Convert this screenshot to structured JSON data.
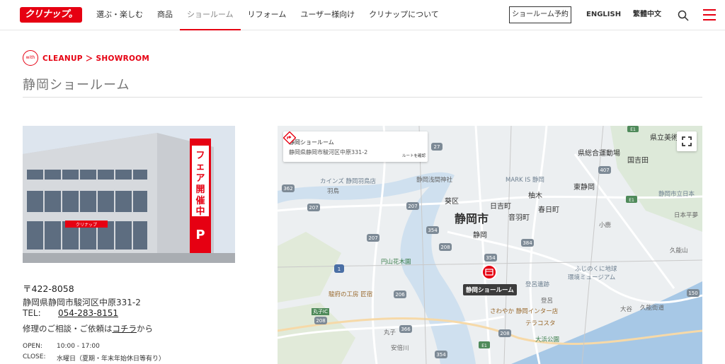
{
  "header": {
    "logo_text": "クリナップ。",
    "nav": [
      "選ぶ・楽しむ",
      "商品",
      "ショールーム",
      "リフォーム",
      "ユーザー様向け",
      "クリナップについて"
    ],
    "active_nav_index": 2,
    "reserve_label": "ショールーム予約",
    "lang_en": "ENGLISH",
    "lang_tw": "繁體中文"
  },
  "brand": {
    "badge": "with",
    "text": "CLEANUP ＞ SHOWROOM"
  },
  "page_title": "静岡ショールーム",
  "photo": {
    "sign_text": "フェア開催中!!",
    "sign_p": "P",
    "building_logo": "クリナップ"
  },
  "info": {
    "postal": "〒422-8058",
    "address": "静岡県静岡市駿河区中原331-2",
    "tel_label": "TEL:",
    "tel": "054-283-8151",
    "repair_text": "修理のご相談・ご依頼は",
    "repair_link": "コチラ",
    "repair_suffix": "から",
    "open_label": "OPEN:",
    "open_value": "10:00 - 17:00",
    "close_label": "CLOSE:",
    "close_value": "水曜日（夏期・年末年始休日等有り）"
  },
  "map": {
    "info_name": "静岡ショールーム",
    "info_addr": "静岡県静岡市駿河区中原331-2",
    "route_label": "ルートを確認",
    "marker_label": "静岡ショールーム",
    "labels": {
      "shizuoka_city": "静岡市",
      "aoi": "葵区",
      "hiyoshi": "日吉町",
      "otowa": "音羽町",
      "yuki": "柚木",
      "kasuga": "春日町",
      "shizuoka_st": "静岡",
      "higashi_shizuoka": "東静岡",
      "mark_is": "MARK IS 静岡",
      "kenritsu": "県立美術",
      "sports": "県総合運動場",
      "kunikichi": "国吉田",
      "shizuoka_shiritsu": "静岡市立日本",
      "nihon_daira": "日本平夢",
      "kainzu": "カインズ 静岡羽鳥店",
      "hatori": "羽鳥",
      "sengen": "静岡浅間神社",
      "enzan": "円山花木園",
      "komaya": "駿府の工房 匠宿",
      "maruko_ic": "丸子IC",
      "maruko": "丸子",
      "abekawa": "安倍川",
      "torodoku": "登呂遺跡",
      "sawayaka": "さわやか 静岡インター店",
      "terracosta": "テラコスタ",
      "ohama": "大浜公園",
      "tosaka": "登呂",
      "fushigi": "ふじのくに地球",
      "kankyo": "環境ミュージアム",
      "ouya": "大谷",
      "kunou": "久能街道",
      "kunou2": "久能山",
      "koshika": "小鹿",
      "fuji": "不二見"
    },
    "route_numbers": [
      "27",
      "67",
      "27",
      "362",
      "207",
      "207",
      "354",
      "208",
      "207",
      "1",
      "208",
      "206",
      "354",
      "384",
      "354",
      "208",
      "366",
      "1",
      "150",
      "1",
      "407",
      "1",
      "208",
      "1"
    ]
  }
}
